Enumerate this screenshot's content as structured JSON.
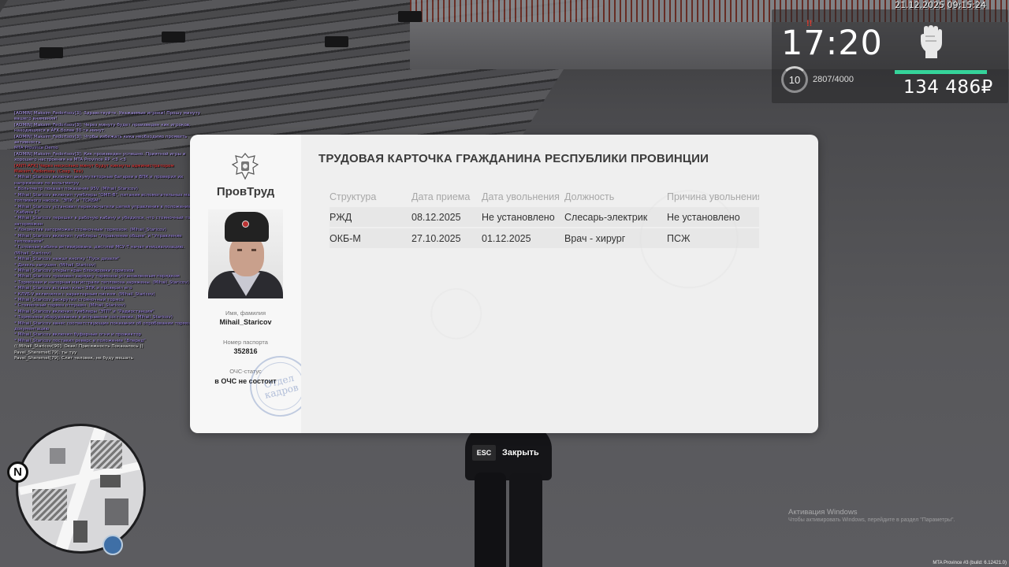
{
  "hud": {
    "datetime": "21.12.2025 09:15:24",
    "time": "17:20",
    "level": "10",
    "xp": "2807/4000",
    "health": 1.0,
    "money": "134 486₽",
    "icon": "fist-icon",
    "accent_color": "#35d39a"
  },
  "chat": {
    "lines": [
      {
        "text": "[ADMIN] Maksim_Fedortsov[3]: Здравствуйте, Уважаемые игроки! Прошу минуту вашего внимания!",
        "style": "admin"
      },
      {
        "text": "[ADMIN] Maksim_Fedortsov[3]: Через минуту будет произведен кик игроков, находящихся в AFK более 30-ти минут.",
        "style": "admin"
      },
      {
        "text": "[ADMIN] Maksim_Fedortsov[3]: Чтобы избежать кика необходимо проявить активность",
        "style": "admin"
      },
      {
        "text": "MTA Province Demo",
        "style": "me"
      },
      {
        "text": "[ADMIN] Maksim_Fedortsov[3]: Кик произведен успешно. Приятной игры и хорошего настроения на MTA Province RP <3 <3",
        "style": "admin"
      },
      {
        "text": "[ANTI-AFK] Через несколько минут будут кикнуты администратором Maksim_Fedortsov. (Сохр. Тех)",
        "style": "warn"
      },
      {
        "text": "* Mihail_Staricov включил аккумуляторные батареи в ВПК и проверил их напряжение по вольтметру",
        "style": "me"
      },
      {
        "text": "* Вольтметр показал показание 95V. (Mihail_Staricov)",
        "style": "me"
      },
      {
        "text": "* Mihail_Staricov включил тумблеры \"ОМП-В\", питания вспомогательных машин, топливного насоса, \"ЭПК\" и \"ТСКБМ\"",
        "style": "me"
      },
      {
        "text": "* Mihail_Staricov установил переключатели цепей управления в положение \"Кабина 1\"",
        "style": "me"
      },
      {
        "text": "* Mihail_Staricov перешел в рабочую кабину и убедился, что стояночный тормоз заторможен",
        "style": "me"
      },
      {
        "text": "* Локомотив заторможен стояночным тормозом. (Mihail_Staricov)",
        "style": "me"
      },
      {
        "text": "* Mihail_Staricov включил тумблеры \"Управление общее\" и \"Управление тепловозом\"",
        "style": "me"
      },
      {
        "text": "* Головная кабина активирована, дисплей МСУ-Т начал инициализацию. (Mihail_Staricov)",
        "style": "me"
      },
      {
        "text": "* Mihail_Staricov нажал кнопку \"Пуск дизеля\"",
        "style": "me"
      },
      {
        "text": "* Дизель запущен. (Mihail_Staricov)",
        "style": "me"
      },
      {
        "text": "* Mihail_Staricov открыл кран блокировки тормозов",
        "style": "me"
      },
      {
        "text": "* Mihail_Staricov произвел зарядку тормозов установленным порядком",
        "style": "me"
      },
      {
        "text": "* Тормозная и напорная магистрали тепловоза заряжены. (Mihail_Staricov)",
        "style": "me"
      },
      {
        "text": "* Mihail_Staricov вставил ключ ЭПК и проверил его",
        "style": "me"
      },
      {
        "text": "* КЛУБ-У включился с характерным писком. (Mihail_Staricov)",
        "style": "me"
      },
      {
        "text": "* Mihail_Staricov раскрутил стояночный тормоз",
        "style": "me"
      },
      {
        "text": "* Стояночный тормоз отпущен. (Mihail_Staricov)",
        "style": "me"
      },
      {
        "text": "* Mihail_Staricov включил тумблеры \"ЭТП\" и \"Радиостанция\"",
        "style": "me"
      },
      {
        "text": "* Тормозное оборудование в исправном состоянии. (Mihail_Staricov)",
        "style": "me"
      },
      {
        "text": "* Mihail_Staricov занес соответствующие показания об опробовании тормозов в документацию",
        "style": "me"
      },
      {
        "text": "* Mihail_Staricov включил буферные огни и прожектор",
        "style": "me"
      },
      {
        "text": "* Mihail_Staricov поставил реверс в положение \"Вперед\"",
        "style": "me"
      },
      {
        "text": "(( Mihail_Staricov[90]: Окак! Присяжность Показалось ))",
        "style": "white"
      },
      {
        "text": "Pavel_Sheremet[79]: ты туу",
        "style": "white"
      },
      {
        "text": "Pavel_Sheremet[79]: Слит человек, не буду мешать",
        "style": "white"
      }
    ]
  },
  "card": {
    "org_name": "ПровТруд",
    "name_label": "Имя, фамилия",
    "name": "Mihail_Staricov",
    "passport_label": "Номер паспорта",
    "passport": "352816",
    "ochs_label": "ОЧС-статус",
    "ochs": "в ОЧС не состоит",
    "stamp_line1": "Отдел",
    "stamp_line2": "кадров",
    "title": "ТРУДОВАЯ КАРТОЧКА ГРАЖДАНИНА РЕСПУБЛИКИ ПРОВИНЦИИ",
    "columns": [
      "Структура",
      "Дата приема",
      "Дата увольнения",
      "Должность",
      "Причина увольнения"
    ],
    "rows": [
      [
        "РЖД",
        "08.12.2025",
        "Не установлено",
        "Слесарь-электрик",
        "Не установлено"
      ],
      [
        "ОКБ-М",
        "27.10.2025",
        "01.12.2025",
        "Врач - хирург",
        "ПСЖ"
      ]
    ]
  },
  "close": {
    "key": "ESC",
    "label": "Закрыть"
  },
  "minimap": {
    "north": "N"
  },
  "watermark": {
    "title": "Активация Windows",
    "subtitle": "Чтобы активировать Windows, перейдите в раздел \"Параметры\".",
    "build": "MTA Province #3 (build: 6.12421.0)"
  }
}
